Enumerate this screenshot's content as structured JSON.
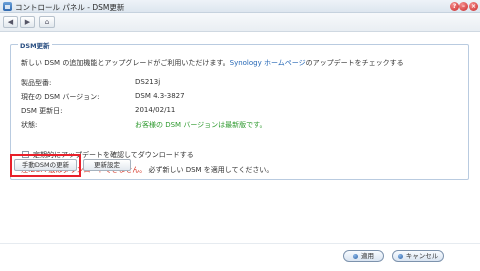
{
  "window": {
    "title": "コントロール パネル - DSM更新",
    "help_icon": "?",
    "minimize_icon": "–",
    "close_icon": "×"
  },
  "toolbar": {
    "back_glyph": "◀",
    "forward_glyph": "▶",
    "home_glyph": "⌂"
  },
  "panel": {
    "legend": "DSM更新",
    "intro_prefix": "新しい DSM の追加機能とアップグレードがご利用いただけます。",
    "intro_link": "Synology ホームページ",
    "intro_suffix": "のアップデートをチェックする",
    "rows": [
      {
        "label": "製品型番:",
        "value": "DS213j"
      },
      {
        "label": "現在の DSM バージョン:",
        "value": "DSM 4.3-3827"
      },
      {
        "label": "DSM 更新日:",
        "value": "2014/02/11"
      },
      {
        "label": "状態:",
        "value": "お客様の DSM バージョンは最新版です。"
      }
    ],
    "auto_check_label": "定期的にアップデートを確認してダウンロードする",
    "auto_check_checked": false,
    "note_red": "注:DSM 版はダウンロードできません。",
    "note_black": "必ず新しい DSM を適用してください。"
  },
  "buttons": {
    "manual_update": "手動DSMの更新",
    "update_settings": "更新設定",
    "apply": "適用",
    "cancel": "キャンセル"
  },
  "colors": {
    "link": "#2466b5",
    "ok_status": "#2e9a2e",
    "warning": "#d22a1a",
    "highlight_box": "#e8202a"
  }
}
